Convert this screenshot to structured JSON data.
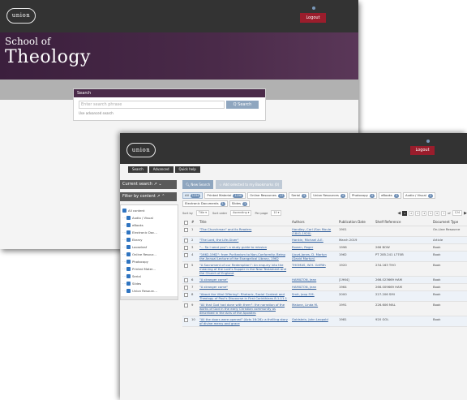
{
  "back": {
    "logo": "union",
    "logout": "Logout",
    "hero_line1": "School of",
    "hero_line2": "Theology",
    "search_title": "Search",
    "search_placeholder": "Enter search phrase",
    "search_button": "Q Search",
    "advanced_link": "Use advanced search"
  },
  "front": {
    "logo": "union",
    "logout": "Logout",
    "tabs": [
      "Search",
      "Advanced",
      "Quick help"
    ],
    "current_search": "Current search",
    "filter_by_content": "Filter by content",
    "tree": [
      "All content",
      "Audio / Visual",
      "eBooks",
      "Electronic Doc...",
      "Ebrary",
      "Looseleaf",
      "Online Resour...",
      "Photocopy",
      "Printed Mater...",
      "Serial",
      "Slides",
      "Union Resourc..."
    ],
    "new_search": "New Search",
    "add_selected": "Add selected to my Bookmarks (0)",
    "chips": [
      {
        "label": "All",
        "count": "1234",
        "active": true
      },
      {
        "label": "Printed Material",
        "count": "1198",
        "active": false
      },
      {
        "label": "Online Resources",
        "count": "17",
        "active": false
      },
      {
        "label": "Serial",
        "count": "5",
        "active": false
      },
      {
        "label": "Union Resources",
        "count": "4",
        "active": false
      },
      {
        "label": "Photocopy",
        "count": "4",
        "active": false
      },
      {
        "label": "eBooks",
        "count": "3",
        "active": false
      },
      {
        "label": "Audio / Visual",
        "count": "2",
        "active": false
      },
      {
        "label": "Electronic Documents",
        "count": "1",
        "active": false
      },
      {
        "label": "Slides",
        "count": "1",
        "active": false
      }
    ],
    "sort_label": "Sort by",
    "sort_value": "Title",
    "sort_order_label": "Sort order",
    "sort_order_value": "Ascending",
    "per_page_label": "Per page",
    "per_page_value": "10",
    "pages": [
      "1",
      "2",
      "3",
      "4",
      "5",
      "6",
      "7"
    ],
    "of_label": "of",
    "total_pages": "124",
    "columns": [
      "#",
      "Title",
      "Authors",
      "Publication Date",
      "Shelf Reference",
      "Document Type"
    ],
    "rows": [
      {
        "n": "1",
        "title": "\"The Churchman\" and its Readers",
        "author": "Handley, Carl (Sun Moule (1841-1920)",
        "date": "1901",
        "shelf": "",
        "type": "On-Line Resource"
      },
      {
        "n": "2",
        "title": "\"The Lord, the Life-Giver\"",
        "author": "Hankin, Michael A.E.",
        "date": "March 2019",
        "shelf": "",
        "type": "Article"
      },
      {
        "n": "3",
        "title": "\"... So I send you\": a study guide to mission",
        "author": "Bowen, Roger",
        "date": "1996",
        "shelf": "266 BOW",
        "type": "Book"
      },
      {
        "n": "4",
        "title": "\"1662-1962\": from Puritanism to Non-Conformity. Being the Annual Lecture of the Evangelical Library, 1962",
        "author": "Lloyd-Jones, D. Martyn (David Martyn)",
        "date": "1962",
        "shelf": "PT 285.241 L770B",
        "type": "Book"
      },
      {
        "n": "5",
        "title": "\"A Sacrament of our Redemption\": An enquiry into the meaning of the Lord's Supper in the New Testament and the Church of England",
        "author": "THOMAS, W.H. Griffith",
        "date": "1920",
        "shelf": "234.163 THO",
        "type": "Book"
      },
      {
        "n": "6",
        "title": "\"A stranger came\"",
        "author": "HAMILTON, Jean",
        "date": "[1964]",
        "shelf": "266.023669 HAM",
        "type": "Book"
      },
      {
        "n": "7",
        "title": "\"A stranger came\"",
        "author": "HAMILTON, Jean",
        "date": "1964",
        "shelf": "266.009669 HAM",
        "type": "Book"
      },
      {
        "n": "8",
        "title": "\"About the Vital Offering\": Rhetoric, Social Context and Theology of Paul's Discourse in First Corinthians 8.1-11.1",
        "author": "Smit, Joop F.M.",
        "date": "2000",
        "shelf": "227.206 SMI",
        "type": "Book"
      },
      {
        "n": "9",
        "title": "\"All that God had done with them\": the narration of the works of God in the early Christian community as described in the Acts of the Apostles",
        "author": "Malone, Linda M.",
        "date": "1991",
        "shelf": "226.606 MAL",
        "type": "Book"
      },
      {
        "n": "10",
        "title": "\"All the doors were opened\" (Acts 16:26): a thrilling story of divine mercy and grace",
        "author": "Goldstein, John Leopold",
        "date": "1981",
        "shelf": "920 GOL",
        "type": "Book"
      }
    ]
  }
}
